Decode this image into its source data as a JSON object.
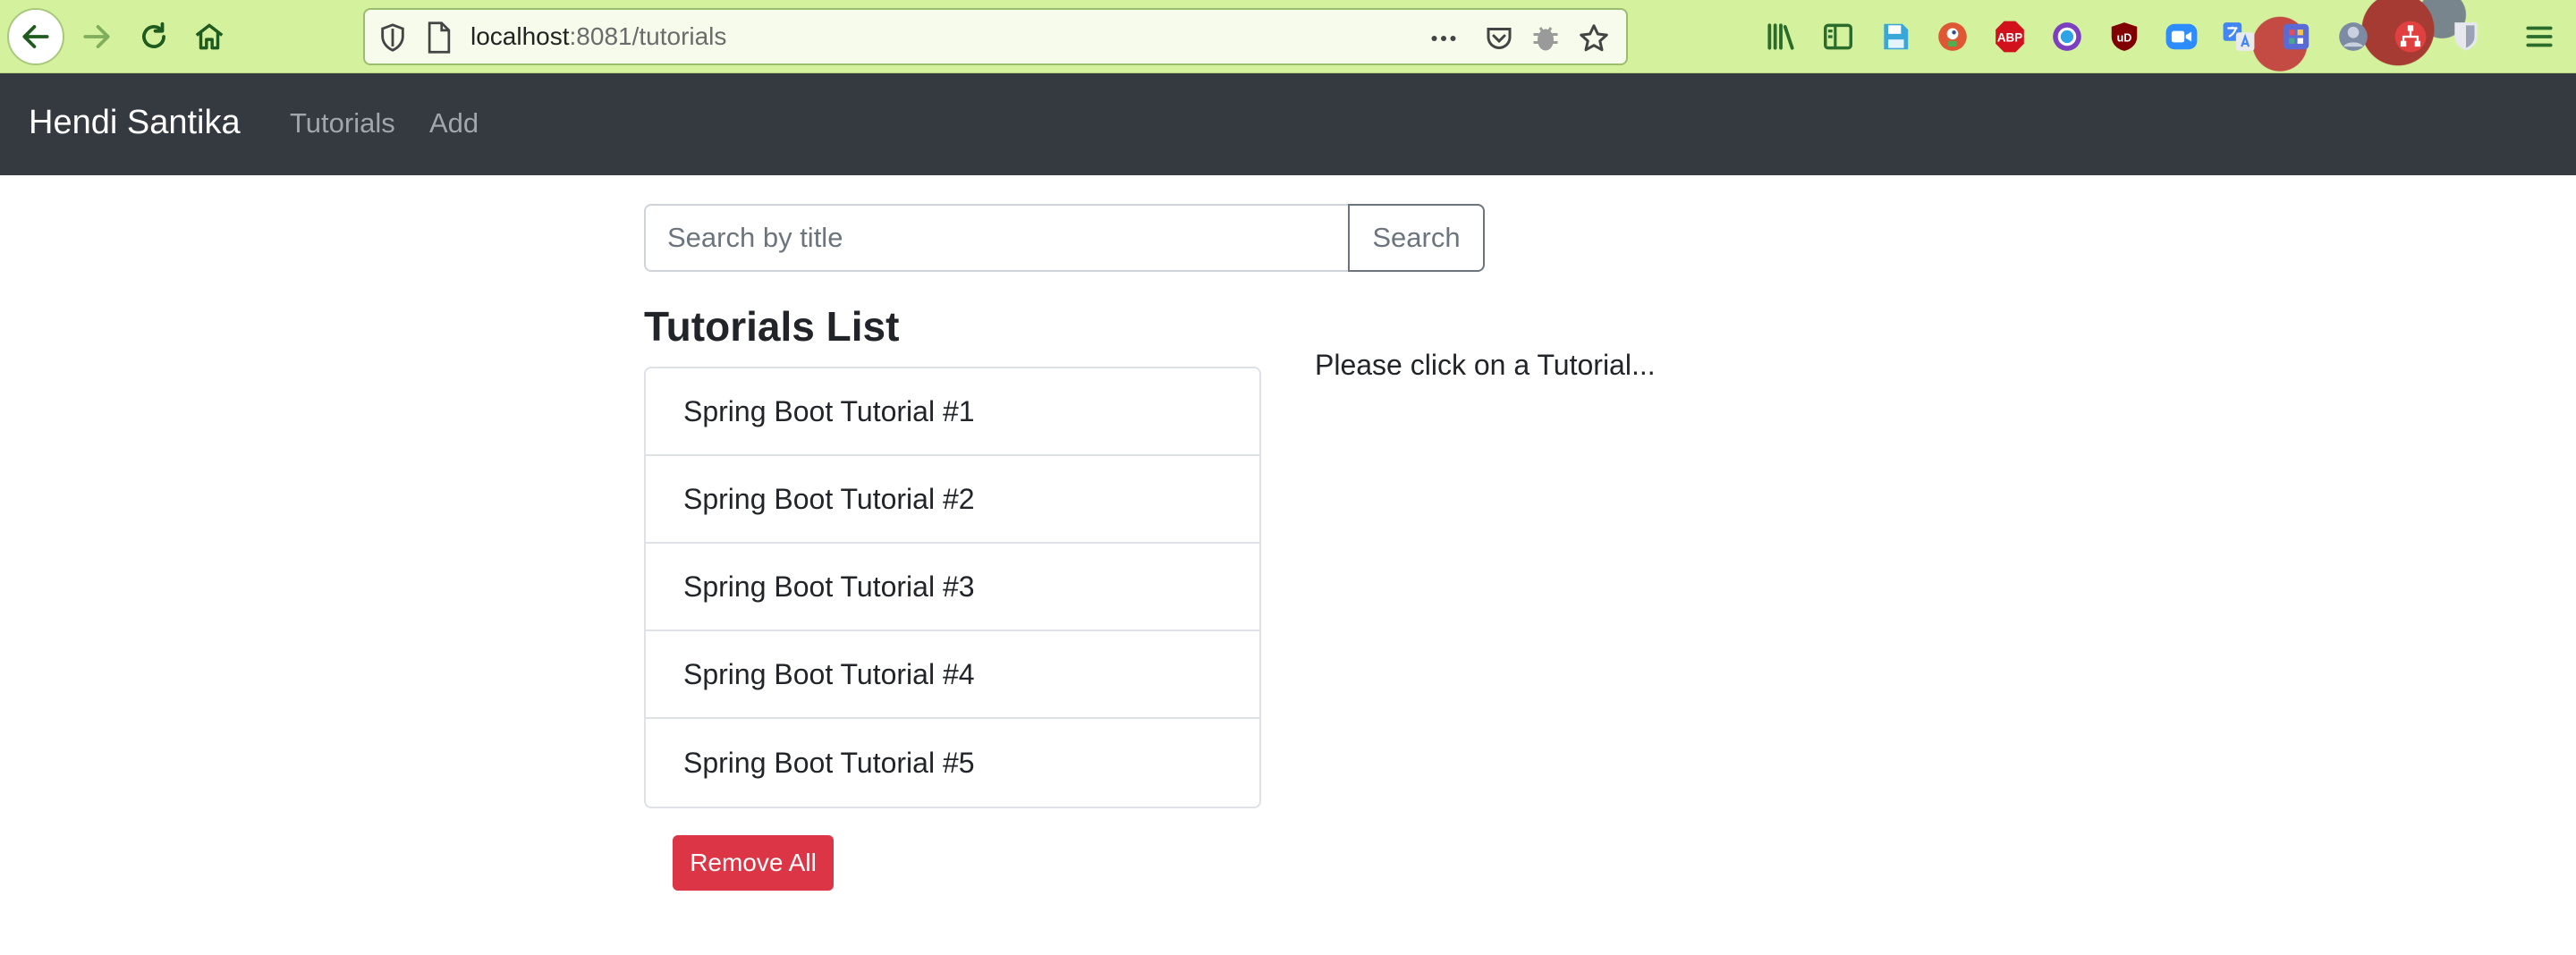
{
  "browser": {
    "url_host": "localhost",
    "url_rest": ":8081/tutorials",
    "extensions": [
      "library-icon",
      "sidebar-icon",
      "save-icon",
      "duckduckgo-icon",
      "adblock-plus-icon",
      "color-picker-icon",
      "ublock-icon",
      "zoom-icon",
      "translate-icon",
      "extension-icon",
      "avatar-extension-icon",
      "sitemap-icon",
      "bitwarden-icon",
      "menu-icon"
    ],
    "extension_labels": {
      "adblock": "ABP",
      "ublock": "uD"
    },
    "theme_color": "#d4f29e"
  },
  "navbar": {
    "brand": "Hendi Santika",
    "links": [
      {
        "label": "Tutorials"
      },
      {
        "label": "Add"
      }
    ],
    "background": "#343a40"
  },
  "search": {
    "placeholder": "Search by title",
    "value": "",
    "button_label": "Search"
  },
  "tutorials": {
    "title": "Tutorials List",
    "items": [
      {
        "label": "Spring Boot Tutorial #1"
      },
      {
        "label": "Spring Boot Tutorial #2"
      },
      {
        "label": "Spring Boot Tutorial #3"
      },
      {
        "label": "Spring Boot Tutorial #4"
      },
      {
        "label": "Spring Boot Tutorial #5"
      }
    ],
    "remove_all_label": "Remove All",
    "remove_all_color": "#dc3545"
  },
  "detail": {
    "hint": "Please click on a Tutorial..."
  }
}
